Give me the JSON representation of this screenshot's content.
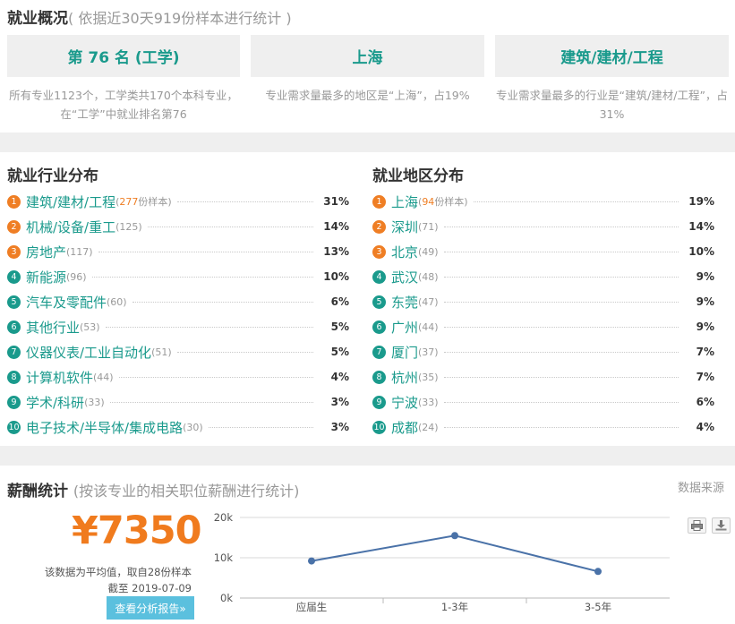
{
  "overview": {
    "title": "就业概况",
    "subtitle": "( 依据近30天919份样本进行统计 )",
    "cards": [
      {
        "value": "第 76 名 (工学)",
        "desc": "所有专业1123个，工学类共170个本科专业，在“工学”中就业排名第76"
      },
      {
        "value": "上海",
        "desc": "专业需求量最多的地区是“上海”，占19%"
      },
      {
        "value": "建筑/建材/工程",
        "desc": "专业需求量最多的行业是“建筑/建材/工程”，占31%"
      }
    ]
  },
  "industry": {
    "title": "就业行业分布",
    "items": [
      {
        "rank": "1",
        "name": "建筑/建材/工程",
        "count": "(277份样本)",
        "pct": "31%"
      },
      {
        "rank": "2",
        "name": "机械/设备/重工",
        "count": "(125)",
        "pct": "14%"
      },
      {
        "rank": "3",
        "name": "房地产",
        "count": "(117)",
        "pct": "13%"
      },
      {
        "rank": "4",
        "name": "新能源",
        "count": "(96)",
        "pct": "10%"
      },
      {
        "rank": "5",
        "name": "汽车及零配件",
        "count": "(60)",
        "pct": "6%"
      },
      {
        "rank": "6",
        "name": "其他行业",
        "count": "(53)",
        "pct": "5%"
      },
      {
        "rank": "7",
        "name": "仪器仪表/工业自动化",
        "count": "(51)",
        "pct": "5%"
      },
      {
        "rank": "8",
        "name": "计算机软件",
        "count": "(44)",
        "pct": "4%"
      },
      {
        "rank": "9",
        "name": "学术/科研",
        "count": "(33)",
        "pct": "3%"
      },
      {
        "rank": "10",
        "name": "电子技术/半导体/集成电路",
        "count": "(30)",
        "pct": "3%"
      }
    ]
  },
  "region": {
    "title": "就业地区分布",
    "items": [
      {
        "rank": "1",
        "name": "上海",
        "count": "(94份样本)",
        "pct": "19%"
      },
      {
        "rank": "2",
        "name": "深圳",
        "count": "(71)",
        "pct": "14%"
      },
      {
        "rank": "3",
        "name": "北京",
        "count": "(49)",
        "pct": "10%"
      },
      {
        "rank": "4",
        "name": "武汉",
        "count": "(48)",
        "pct": "9%"
      },
      {
        "rank": "5",
        "name": "东莞",
        "count": "(47)",
        "pct": "9%"
      },
      {
        "rank": "6",
        "name": "广州",
        "count": "(44)",
        "pct": "9%"
      },
      {
        "rank": "7",
        "name": "厦门",
        "count": "(37)",
        "pct": "7%"
      },
      {
        "rank": "8",
        "name": "杭州",
        "count": "(35)",
        "pct": "7%"
      },
      {
        "rank": "9",
        "name": "宁波",
        "count": "(33)",
        "pct": "6%"
      },
      {
        "rank": "10",
        "name": "成都",
        "count": "(24)",
        "pct": "4%"
      }
    ]
  },
  "salary": {
    "title": "薪酬统计",
    "subtitle": "(按该专业的相关职位薪酬进行统计)",
    "source_link": "数据来源",
    "average": "¥7350",
    "note_line1": "该数据为平均值，取自28份样本",
    "note_line2": "截至 2019-07-09",
    "report_button": "查看分析报告»",
    "print_icon": "print-icon",
    "download_icon": "download-icon"
  },
  "colors": {
    "accent": "#1a9a8c",
    "orange": "#f07b1e",
    "line": "#4a72a8",
    "button": "#5bc0de"
  },
  "chart_data": {
    "type": "line",
    "categories": [
      "应届生",
      "1-3年",
      "3-5年"
    ],
    "values": [
      9200,
      15500,
      6600
    ],
    "ylim": [
      0,
      20000
    ],
    "yticks": [
      0,
      10000,
      20000
    ],
    "ytick_labels": [
      "0k",
      "10k",
      "20k"
    ],
    "grid": true,
    "title": "",
    "xlabel": "",
    "ylabel": ""
  }
}
